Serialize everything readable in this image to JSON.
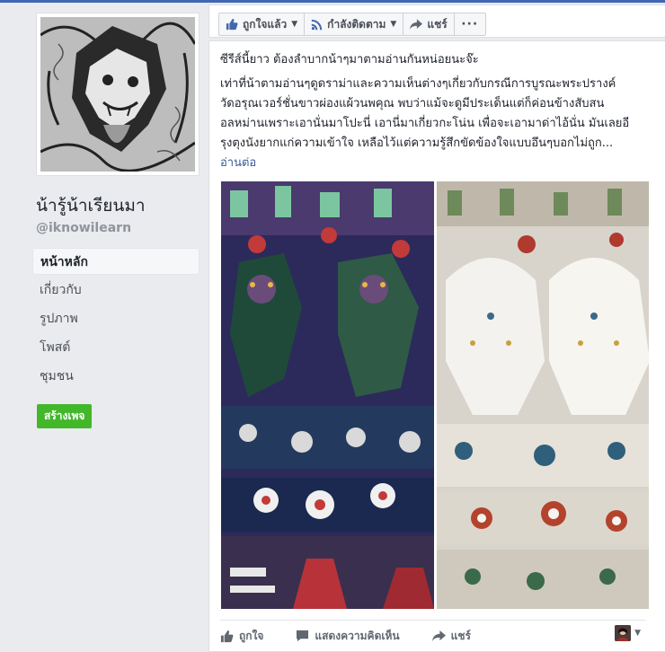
{
  "page": {
    "name": "น้ารู้น้าเรียนมา",
    "handle": "@iknowilearn"
  },
  "nav": [
    {
      "label": "หน้าหลัก",
      "active": true
    },
    {
      "label": "เกี่ยวกับ",
      "active": false
    },
    {
      "label": "รูปภาพ",
      "active": false
    },
    {
      "label": "โพสต์",
      "active": false
    },
    {
      "label": "ชุมชน",
      "active": false
    }
  ],
  "create_page": "สร้างเพจ",
  "action_bar": {
    "liked": "ถูกใจแล้ว",
    "following": "กำลังติดตาม",
    "share": "แชร์",
    "more": "···"
  },
  "post": {
    "heading": "ซีรีส์นี้ยาว ต้องลำบากน้าๆมาตามอ่านกันหน่อยนะจ๊ะ",
    "lines": [
      "เท่าที่น้าตามอ่านๆดูดราม่าและความเห็นต่างๆเกี่ยวกับกรณีการบูรณะพระปรางค์",
      "วัดอรุณเวอร์ชั่นขาวผ่องแผ้วนพคุณ พบว่าแม้จะดูมีประเด็นแต่ก็ค่อนข้างสับสน",
      "อลหม่านเพราะเอานั่นมาโปะนี่ เอานี่มาเกี่ยวกะโน่น เพื่อจะเอามาด่าไอ้นั่น มันเลยอี",
      "รุงตุงนังยากแก่ความเข้าใจ เหลือไว้แต่ความรู้สึกขัดข้องใจแบบอึนๆบอกไม่ถูก..."
    ],
    "read_more": "อ่านต่อ"
  },
  "footer": {
    "like": "ถูกใจ",
    "comment": "แสดงความคิดเห็น",
    "share": "แชร์"
  },
  "colors": {
    "brand": "#4267b2",
    "link": "#365899",
    "create_button": "#42b72a"
  }
}
